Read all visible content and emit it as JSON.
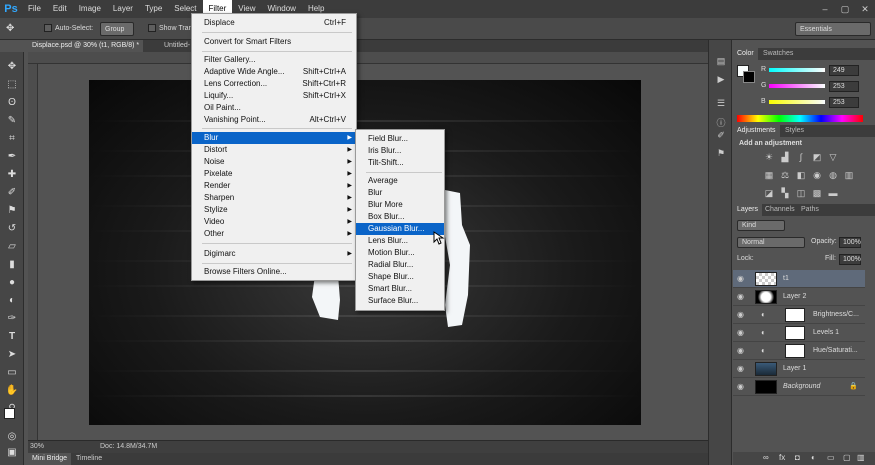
{
  "app": {
    "logo": "Ps"
  },
  "menubar": [
    "File",
    "Edit",
    "Image",
    "Layer",
    "Type",
    "Select",
    "Filter",
    "View",
    "Window",
    "Help"
  ],
  "window_controls": [
    "–",
    "▢",
    "✕"
  ],
  "options": {
    "auto_select": "Auto-Select:",
    "group": "Group",
    "show_transform": "Show Tran",
    "workspace": "Essentials"
  },
  "doc_tabs": [
    "Displace.psd @ 30% (t1, RGB/8) *",
    "Untitled-"
  ],
  "status": {
    "zoom": "30%",
    "doc": "Doc: 14.8M/34.7M"
  },
  "bottom_tabs": [
    "Mini Bridge",
    "Timeline"
  ],
  "filter_menu": [
    {
      "label": "Displace",
      "shortcut": "Ctrl+F"
    },
    {
      "label": "Convert for Smart Filters"
    },
    {
      "label": "Filter Gallery..."
    },
    {
      "label": "Adaptive Wide Angle...",
      "shortcut": "Shift+Ctrl+A"
    },
    {
      "label": "Lens Correction...",
      "shortcut": "Shift+Ctrl+R"
    },
    {
      "label": "Liquify...",
      "shortcut": "Shift+Ctrl+X"
    },
    {
      "label": "Oil Paint..."
    },
    {
      "label": "Vanishing Point...",
      "shortcut": "Alt+Ctrl+V"
    },
    {
      "label": "Blur"
    },
    {
      "label": "Distort"
    },
    {
      "label": "Noise"
    },
    {
      "label": "Pixelate"
    },
    {
      "label": "Render"
    },
    {
      "label": "Sharpen"
    },
    {
      "label": "Stylize"
    },
    {
      "label": "Video"
    },
    {
      "label": "Other"
    },
    {
      "label": "Digimarc"
    },
    {
      "label": "Browse Filters Online..."
    }
  ],
  "blur_menu": [
    "Field Blur...",
    "Iris Blur...",
    "Tilt-Shift...",
    "Average",
    "Blur",
    "Blur More",
    "Box Blur...",
    "Gaussian Blur...",
    "Lens Blur...",
    "Motion Blur...",
    "Radial Blur...",
    "Shape Blur...",
    "Smart Blur...",
    "Surface Blur..."
  ],
  "color_panel": {
    "tabs": [
      "Color",
      "Swatches"
    ],
    "r": "249",
    "g": "253",
    "b": "253",
    "r_label": "R",
    "g_label": "G",
    "b_label": "B"
  },
  "adjustments_panel": {
    "tabs": [
      "Adjustments",
      "Styles"
    ],
    "title": "Add an adjustment"
  },
  "layers_panel": {
    "tabs": [
      "Layers",
      "Channels",
      "Paths"
    ],
    "kind": "Kind",
    "blend": "Normal",
    "opacity_label": "Opacity:",
    "opacity": "100%",
    "fill_label": "Fill:",
    "fill": "100%",
    "lock_label": "Lock:",
    "layers": [
      "t1",
      "Layer 2",
      "Brightness/C...",
      "Levels 1",
      "Hue/Saturati...",
      "Layer 1",
      "Background"
    ]
  },
  "colors": {
    "highlight": "#0a64c8",
    "accent": "#31a8ff"
  }
}
